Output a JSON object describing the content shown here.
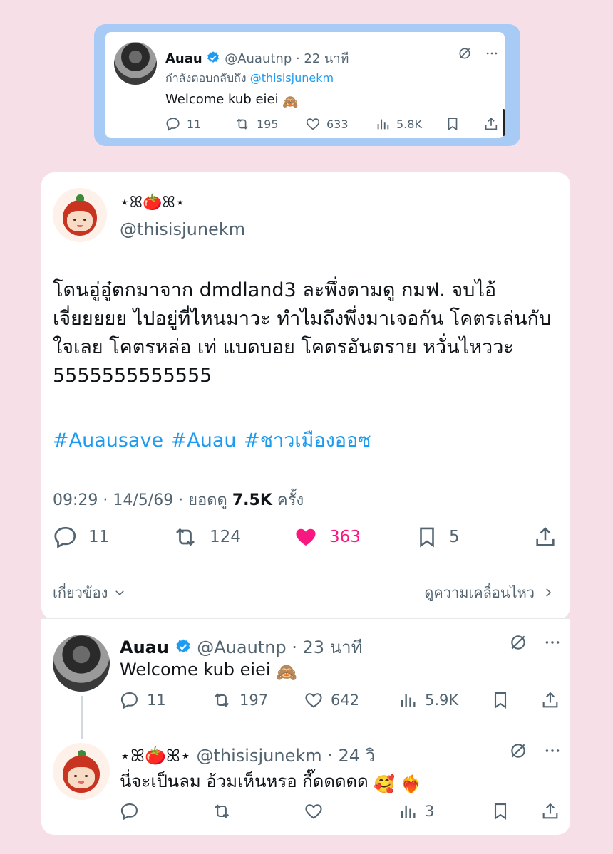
{
  "top_tweet": {
    "name": "Auau",
    "handle": "@Auautnp",
    "time": "22 นาที",
    "reply_prefix": "กำลังตอบกลับถึง",
    "reply_to": "@thisisjunekm",
    "text": "Welcome kub eiei",
    "replies": "11",
    "retweets": "195",
    "likes": "633",
    "views": "5.8K"
  },
  "main_tweet": {
    "name": "⋆ꕤ🍅ꕤ⋆",
    "handle": "@thisisjunekm",
    "text": "โดนอู่อู๋ตกมาจาก dmdland3 ละพึ่งตามดู กมฟ. จบไอ้เจี่ยยยยย ไปอยู่ที่ไหนมาวะ ทำไมถึงพึ่งมาเจอกัน โคตรเล่นกับใจเลย โคตรหล่อ เท่ แบดบอย โคตรอันตราย หวั่นไหววะ 5555555555555",
    "hashtags": "#Auausave #Auau #ชาวเมืองออซ",
    "time": "09:29 · 14/5/69 · ยอดดู",
    "views": "7.5K",
    "views_suffix": "ครั้ง",
    "replies": "11",
    "retweets": "124",
    "likes": "363",
    "bookmarks": "5",
    "related_label": "เกี่ยวข้อง",
    "motion_label": "ดูความเคลื่อนไหว",
    "like_color": "#f91880"
  },
  "reply1": {
    "name": "Auau",
    "handle": "@Auautnp",
    "time": "23 นาที",
    "text": "Welcome kub eiei",
    "replies": "11",
    "retweets": "197",
    "likes": "642",
    "views": "5.9K"
  },
  "reply2": {
    "name": "⋆ꕤ🍅ꕤ⋆",
    "handle": "@thisisjunekm",
    "time": "24 วิ",
    "text": "นี่จะเป็นลม อ้วมเห็นหรอ กี๊ดดดดด",
    "views": "3"
  },
  "colors": {
    "accent": "#1d9bf0",
    "background": "#f6dfe7",
    "top_frame": "#a8cbf5"
  }
}
